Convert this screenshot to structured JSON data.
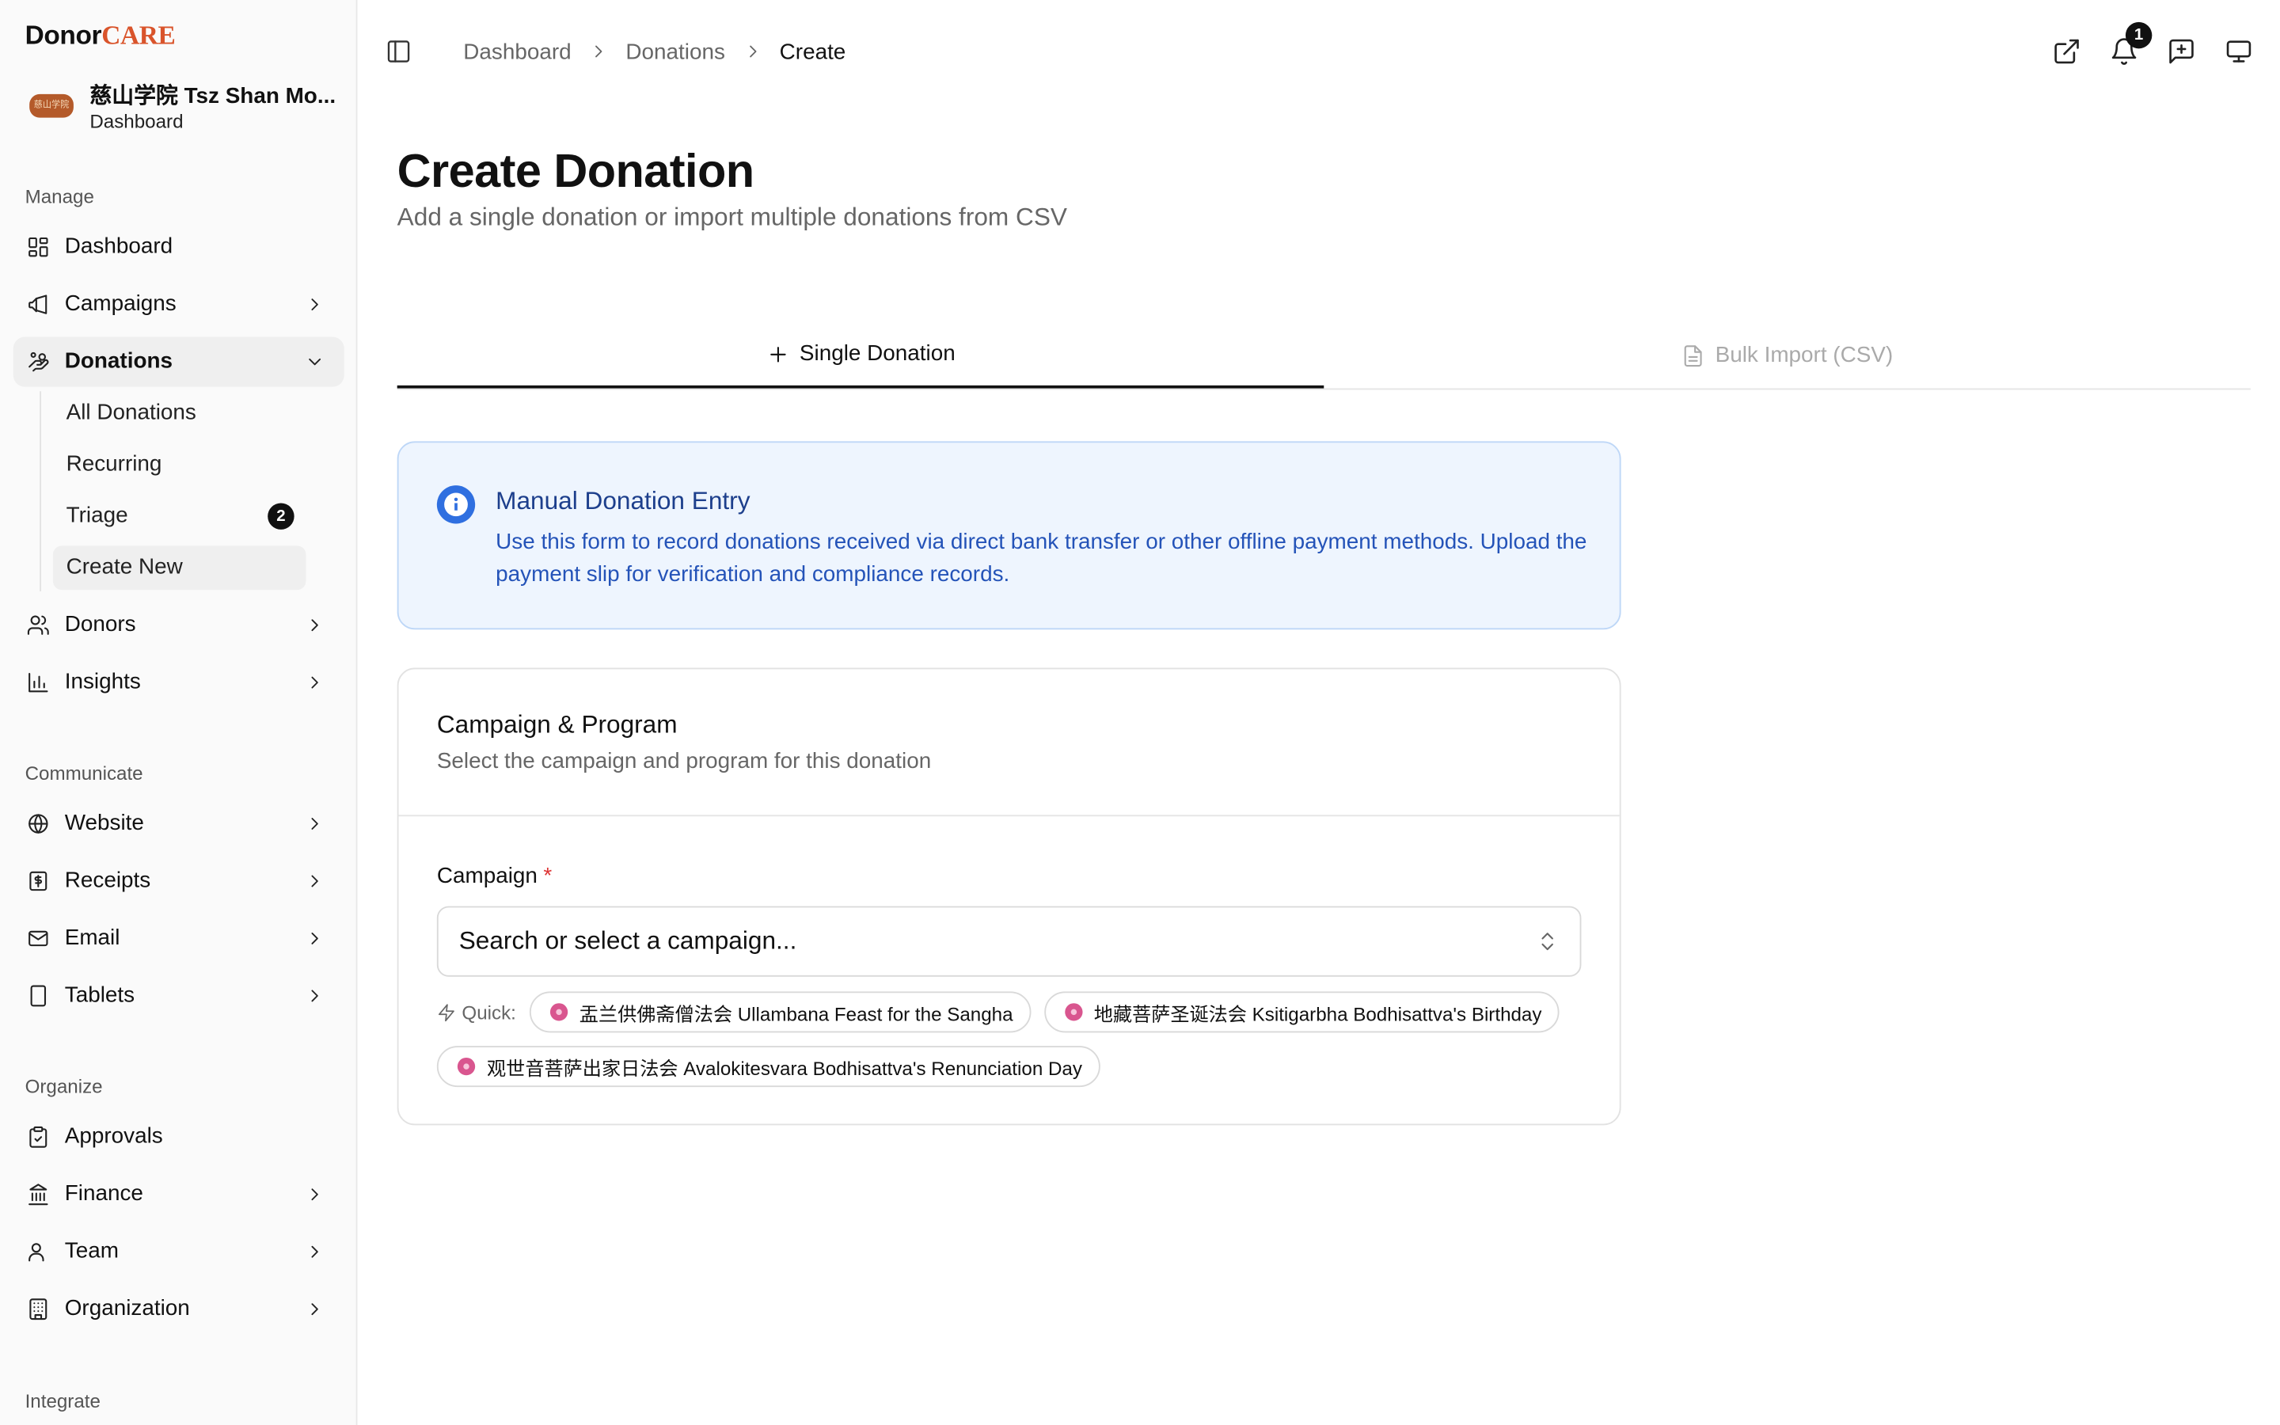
{
  "brand": {
    "part1": "Donor",
    "part2": "CARE"
  },
  "org": {
    "name": "慈山学院 Tsz Shan Mo...",
    "subtitle": "Dashboard",
    "logo_text": "慈山学院"
  },
  "sidebar": {
    "sections": {
      "manage": "Manage",
      "communicate": "Communicate",
      "organize": "Organize",
      "integrate": "Integrate"
    },
    "manage_items": [
      {
        "label": "Dashboard",
        "icon": "layout-grid-icon"
      },
      {
        "label": "Campaigns",
        "icon": "megaphone-icon"
      },
      {
        "label": "Donations",
        "icon": "hand-coins-icon",
        "expanded": true
      }
    ],
    "donations_sub": [
      {
        "label": "All Donations"
      },
      {
        "label": "Recurring"
      },
      {
        "label": "Triage",
        "badge": "2"
      },
      {
        "label": "Create New",
        "active": true
      }
    ],
    "manage_more": [
      {
        "label": "Donors",
        "icon": "users-icon"
      },
      {
        "label": "Insights",
        "icon": "bar-chart-icon"
      }
    ],
    "communicate_items": [
      {
        "label": "Website",
        "icon": "globe-icon"
      },
      {
        "label": "Receipts",
        "icon": "receipt-icon"
      },
      {
        "label": "Email",
        "icon": "mail-icon"
      },
      {
        "label": "Tablets",
        "icon": "tablet-icon"
      }
    ],
    "organize_items": [
      {
        "label": "Approvals",
        "icon": "clipboard-check-icon"
      },
      {
        "label": "Finance",
        "icon": "landmark-icon"
      },
      {
        "label": "Team",
        "icon": "user-icon"
      },
      {
        "label": "Organization",
        "icon": "building-icon"
      }
    ]
  },
  "topbar": {
    "breadcrumbs": [
      "Dashboard",
      "Donations",
      "Create"
    ],
    "notification_count": "1",
    "icons": [
      "external-link-icon",
      "bell-icon",
      "message-plus-icon",
      "monitor-icon"
    ]
  },
  "main": {
    "title": "Create Donation",
    "subtitle": "Add a single donation or import multiple donations from CSV",
    "tabs": [
      {
        "label": "Single Donation",
        "active": true,
        "icon": "plus-icon"
      },
      {
        "label": "Bulk Import (CSV)",
        "active": false,
        "icon": "file-text-icon"
      }
    ],
    "info": {
      "title": "Manual Donation Entry",
      "text": "Use this form to record donations received via direct bank transfer or other offline payment methods. Upload the payment slip for verification and compliance records."
    },
    "card": {
      "title": "Campaign & Program",
      "subtitle": "Select the campaign and program for this donation",
      "field_label": "Campaign",
      "required_mark": "*",
      "select_placeholder": "Search or select a campaign...",
      "quick_label": "Quick:",
      "quick_chips": [
        "盂兰供佛斋僧法会 Ullambana Feast for the Sangha",
        "地藏菩萨圣诞法会 Ksitigarbha Bodhisattva's Birthday",
        "观世音菩萨出家日法会 Avalokitesvara Bodhisattva's Renunciation Day"
      ]
    }
  },
  "colors": {
    "brand_accent": "#d9542b",
    "info_bg": "#eef5fe",
    "info_border": "#bed7f7",
    "info_title": "#1d3f8c",
    "info_text": "#2453b8",
    "required": "#dd3333"
  }
}
